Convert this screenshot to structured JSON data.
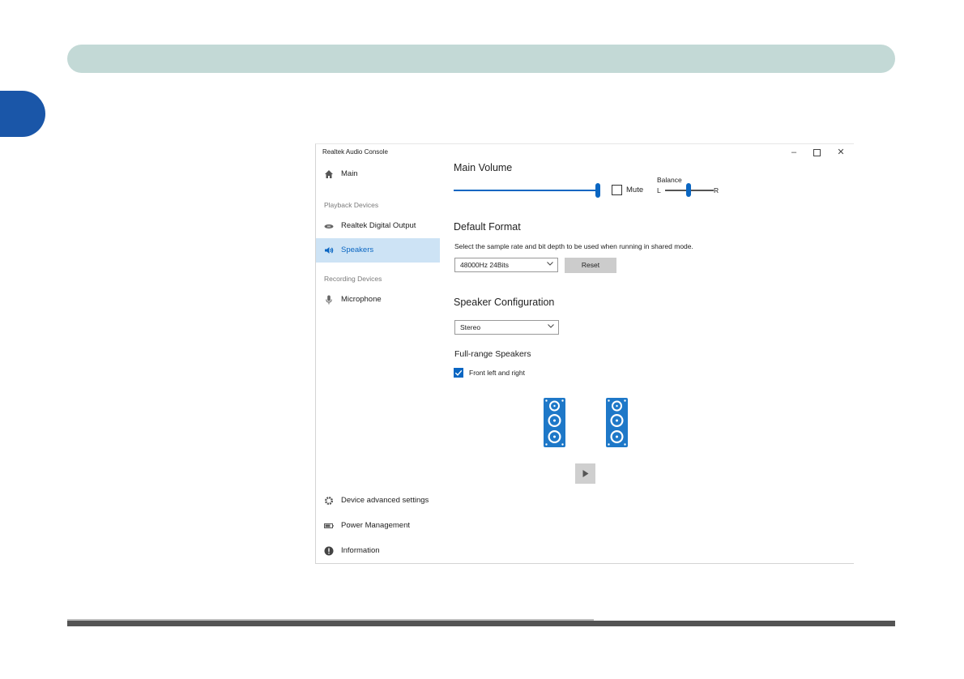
{
  "window": {
    "title": "Realtek Audio Console",
    "controls": {
      "minimize": "–",
      "close": "✕"
    }
  },
  "sidebar": {
    "main_label": "Main",
    "playback_section": "Playback Devices",
    "playback_items": [
      "Realtek Digital Output",
      "Speakers"
    ],
    "selected_item": "Speakers",
    "recording_section": "Recording Devices",
    "recording_items": [
      "Microphone"
    ],
    "bottom_items": [
      "Device advanced settings",
      "Power Management",
      "Information"
    ]
  },
  "main_volume": {
    "title": "Main Volume",
    "level_percent": 100,
    "mute_label": "Mute",
    "mute_checked": false,
    "balance_label": "Balance",
    "balance_left": "L",
    "balance_right": "R",
    "balance_percent": 50
  },
  "default_format": {
    "title": "Default Format",
    "description": "Select the sample rate and bit depth to be used when running in shared mode.",
    "selected_value": "48000Hz 24Bits",
    "reset_label": "Reset"
  },
  "speaker_configuration": {
    "title": "Speaker Configuration",
    "selected_value": "Stereo",
    "full_range_title": "Full-range Speakers",
    "front_lr_label": "Front left and right",
    "front_lr_checked": true
  },
  "colors": {
    "accent": "#0a66c2",
    "selected_bg": "#cde3f5",
    "banner": "#c3d9d6",
    "page_tab": "#1a56a8"
  },
  "icons": {
    "main": "home-icon",
    "digital_output": "digital-output-icon",
    "speakers": "speaker-icon",
    "microphone": "microphone-icon",
    "advanced": "gear-icon",
    "power": "battery-icon",
    "information": "info-icon",
    "play": "play-icon"
  }
}
